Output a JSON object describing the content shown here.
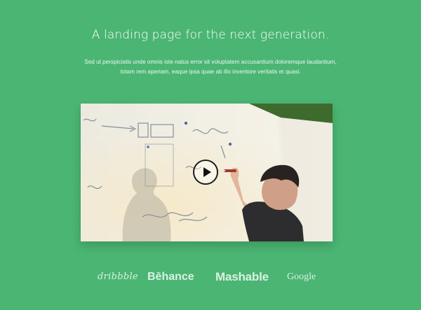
{
  "hero": {
    "title": "A landing page for the next generation.",
    "description_lines": [
      "Sed ut perspiciatis unde omnis iste natus error sit voluptatem accusantium doloremque laudantium,",
      "totam rem aperiam, eaque ipsa quae ab illo inventore veritatis et quasi."
    ]
  },
  "video": {
    "play_icon": "play-icon"
  },
  "logos": [
    {
      "name": "dribbble",
      "text": "dribbble"
    },
    {
      "name": "behance",
      "text": "Bēhance"
    },
    {
      "name": "mashable",
      "text": "Mashable"
    },
    {
      "name": "google",
      "text": "Google"
    }
  ],
  "colors": {
    "background": "#4bb673",
    "text": "#ffffff",
    "play_ring": "#1c1c1c"
  }
}
